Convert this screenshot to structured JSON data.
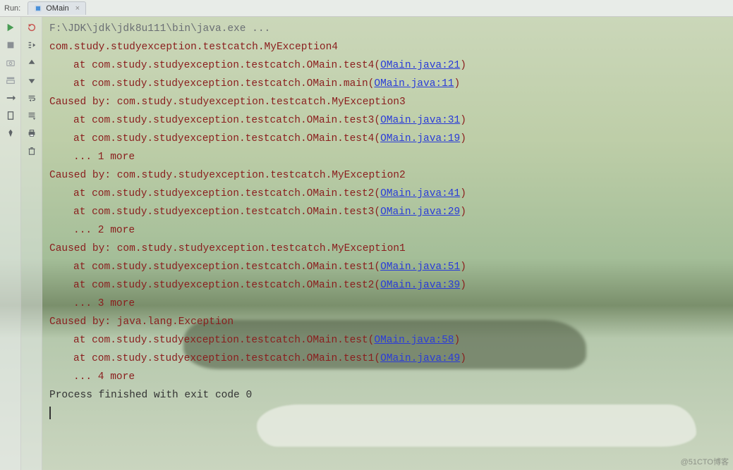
{
  "header": {
    "run_label": "Run:",
    "tab_name": "OMain",
    "tab_close": "×"
  },
  "icons": {
    "col1": [
      "run",
      "stop",
      "camera",
      "layout",
      "force",
      "mark",
      "pin"
    ],
    "col2": [
      "restart",
      "steps",
      "up",
      "down",
      "wrap",
      "wrap2",
      "print",
      "trash"
    ]
  },
  "console": {
    "lines": [
      {
        "cls": "cmd",
        "text": "F:\\JDK\\jdk\\jdk8u111\\bin\\java.exe ..."
      },
      {
        "cls": "exc",
        "text": "com.study.studyexception.testcatch.MyException4"
      },
      {
        "cls": "at",
        "indent": 1,
        "pre": "at com.study.studyexception.testcatch.OMain.test4(",
        "link": "OMain.java:21",
        "post": ")"
      },
      {
        "cls": "at",
        "indent": 1,
        "pre": "at com.study.studyexception.testcatch.OMain.main(",
        "link": "OMain.java:11",
        "post": ")"
      },
      {
        "cls": "exc",
        "text": "Caused by: com.study.studyexception.testcatch.MyException3"
      },
      {
        "cls": "at",
        "indent": 1,
        "pre": "at com.study.studyexception.testcatch.OMain.test3(",
        "link": "OMain.java:31",
        "post": ")"
      },
      {
        "cls": "at",
        "indent": 1,
        "pre": "at com.study.studyexception.testcatch.OMain.test4(",
        "link": "OMain.java:19",
        "post": ")"
      },
      {
        "cls": "more",
        "indent": 1,
        "text": "... 1 more"
      },
      {
        "cls": "exc",
        "text": "Caused by: com.study.studyexception.testcatch.MyException2"
      },
      {
        "cls": "at",
        "indent": 1,
        "pre": "at com.study.studyexception.testcatch.OMain.test2(",
        "link": "OMain.java:41",
        "post": ")"
      },
      {
        "cls": "at",
        "indent": 1,
        "pre": "at com.study.studyexception.testcatch.OMain.test3(",
        "link": "OMain.java:29",
        "post": ")"
      },
      {
        "cls": "more",
        "indent": 1,
        "text": "... 2 more"
      },
      {
        "cls": "exc",
        "text": "Caused by: com.study.studyexception.testcatch.MyException1"
      },
      {
        "cls": "at",
        "indent": 1,
        "pre": "at com.study.studyexception.testcatch.OMain.test1(",
        "link": "OMain.java:51",
        "post": ")"
      },
      {
        "cls": "at",
        "indent": 1,
        "pre": "at com.study.studyexception.testcatch.OMain.test2(",
        "link": "OMain.java:39",
        "post": ")"
      },
      {
        "cls": "more",
        "indent": 1,
        "text": "... 3 more"
      },
      {
        "cls": "exc",
        "text": "Caused by: java.lang.Exception"
      },
      {
        "cls": "at",
        "indent": 1,
        "pre": "at com.study.studyexception.testcatch.OMain.test(",
        "link": "OMain.java:58",
        "post": ")"
      },
      {
        "cls": "at",
        "indent": 1,
        "pre": "at com.study.studyexception.testcatch.OMain.test1(",
        "link": "OMain.java:49",
        "post": ")"
      },
      {
        "cls": "more",
        "indent": 1,
        "text": "... 4 more"
      },
      {
        "cls": "blank",
        "text": ""
      },
      {
        "cls": "exit",
        "text": "Process finished with exit code 0"
      }
    ]
  },
  "watermark": "@51CTO博客"
}
